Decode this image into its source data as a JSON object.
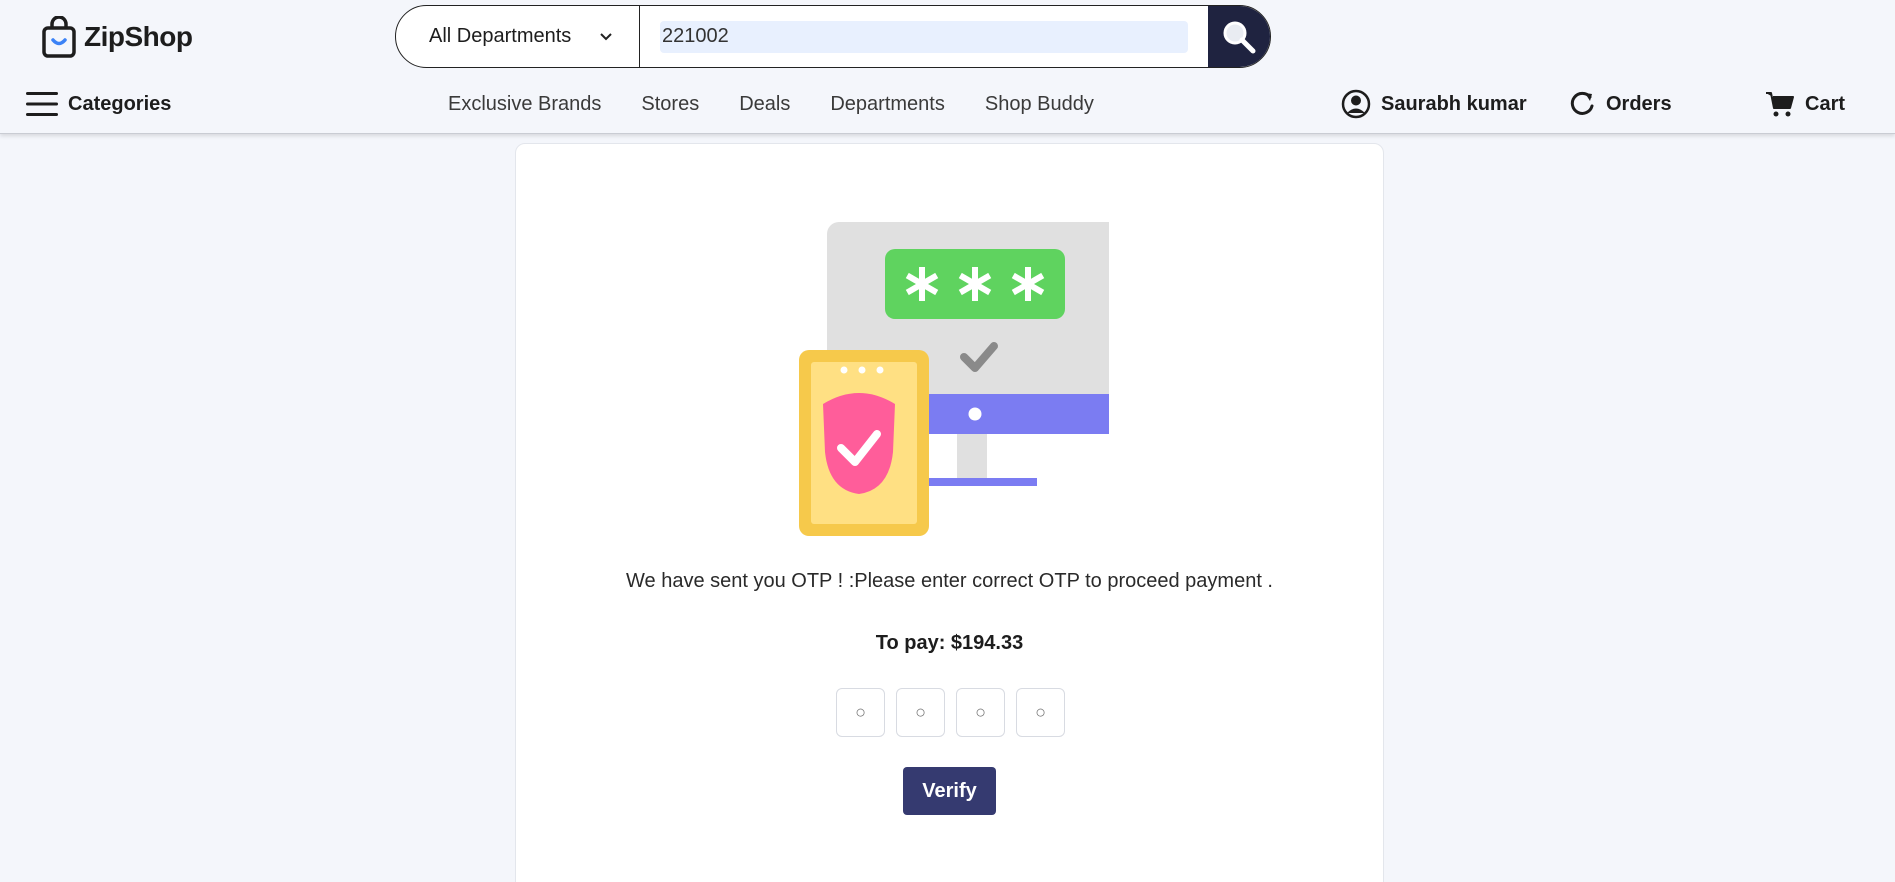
{
  "brand": {
    "name": "ZipShop",
    "accent": "#3b82f6"
  },
  "search": {
    "department": "All Departments",
    "value": "221002"
  },
  "nav": {
    "categories_label": "Categories",
    "links": [
      "Exclusive Brands",
      "Stores",
      "Deals",
      "Departments",
      "Shop Buddy"
    ],
    "user_name": "Saurabh kumar",
    "orders_label": "Orders",
    "cart_label": "Cart"
  },
  "otp": {
    "message": "We have sent you OTP ! :Please enter correct OTP to proceed payment .",
    "to_pay": "To pay: $194.33",
    "placeholders": [
      "○",
      "○",
      "○",
      "○"
    ],
    "verify_label": "Verify"
  },
  "colors": {
    "header_bg": "#f4f6fb",
    "search_button": "#1f2340",
    "verify_button": "#353a70",
    "monitor_band": "#7b7cf2",
    "password_box": "#5fd35f",
    "phone": "#f6c94b",
    "shield": "#ff5d9a"
  },
  "icons": [
    "shopping-bag-icon",
    "chevron-down-icon",
    "search-icon",
    "hamburger-icon",
    "user-icon",
    "refresh-icon",
    "cart-icon"
  ]
}
